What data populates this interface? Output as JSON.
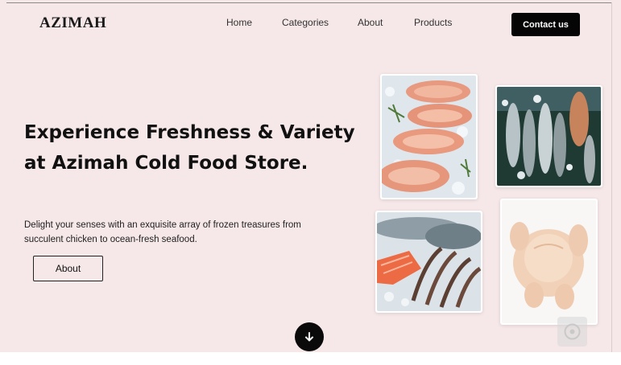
{
  "brand": {
    "name": "AZIMAH"
  },
  "nav": {
    "items": [
      {
        "label": "Home"
      },
      {
        "label": "Categories"
      },
      {
        "label": "About"
      },
      {
        "label": "Products"
      }
    ],
    "contact_label": "Contact us"
  },
  "hero": {
    "headline": "Experience Freshness & Variety at Azimah Cold Food Store.",
    "subtext": "Delight your senses with an exquisite array of frozen treasures from succulent chicken to ocean-fresh seafood.",
    "cta_label": "About"
  },
  "gallery": [
    {
      "icon": "salmon-steaks-image"
    },
    {
      "icon": "fish-on-ice-image"
    },
    {
      "icon": "seafood-platter-image"
    },
    {
      "icon": "whole-chicken-image"
    }
  ],
  "colors": {
    "hero_background": "#f6e8e8",
    "button_dark": "#050505",
    "text": "#111111"
  },
  "icons": {
    "scroll": "arrow-down-icon",
    "widget": "floating-widget-icon"
  }
}
